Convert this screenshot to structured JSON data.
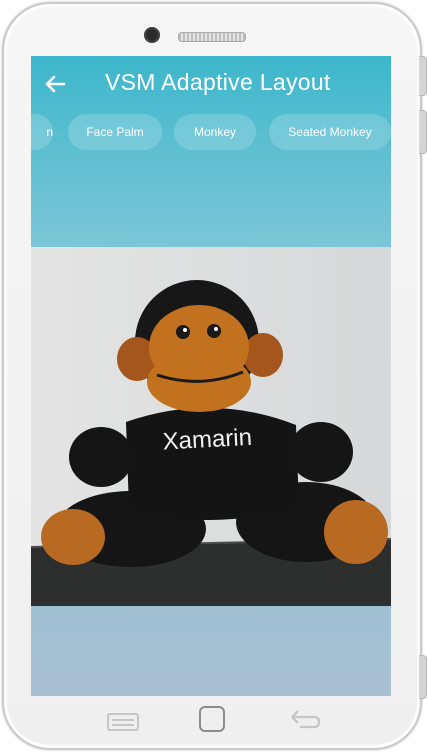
{
  "app": {
    "title": "VSM Adaptive Layout"
  },
  "chips": [
    {
      "label": "n",
      "name": "chip-partial"
    },
    {
      "label": "Face Palm",
      "name": "chip-face-palm"
    },
    {
      "label": "Monkey",
      "name": "chip-monkey"
    },
    {
      "label": "Seated Monkey",
      "name": "chip-seated-monkey"
    }
  ],
  "photo": {
    "shirt_text": "Xamarin"
  },
  "icons": {
    "back": "arrow-left-icon",
    "nav_recents": "recents-icon",
    "nav_home": "home-icon",
    "nav_back": "back-icon"
  },
  "colors": {
    "accent": "#3db7cc",
    "text": "#ffffff"
  }
}
